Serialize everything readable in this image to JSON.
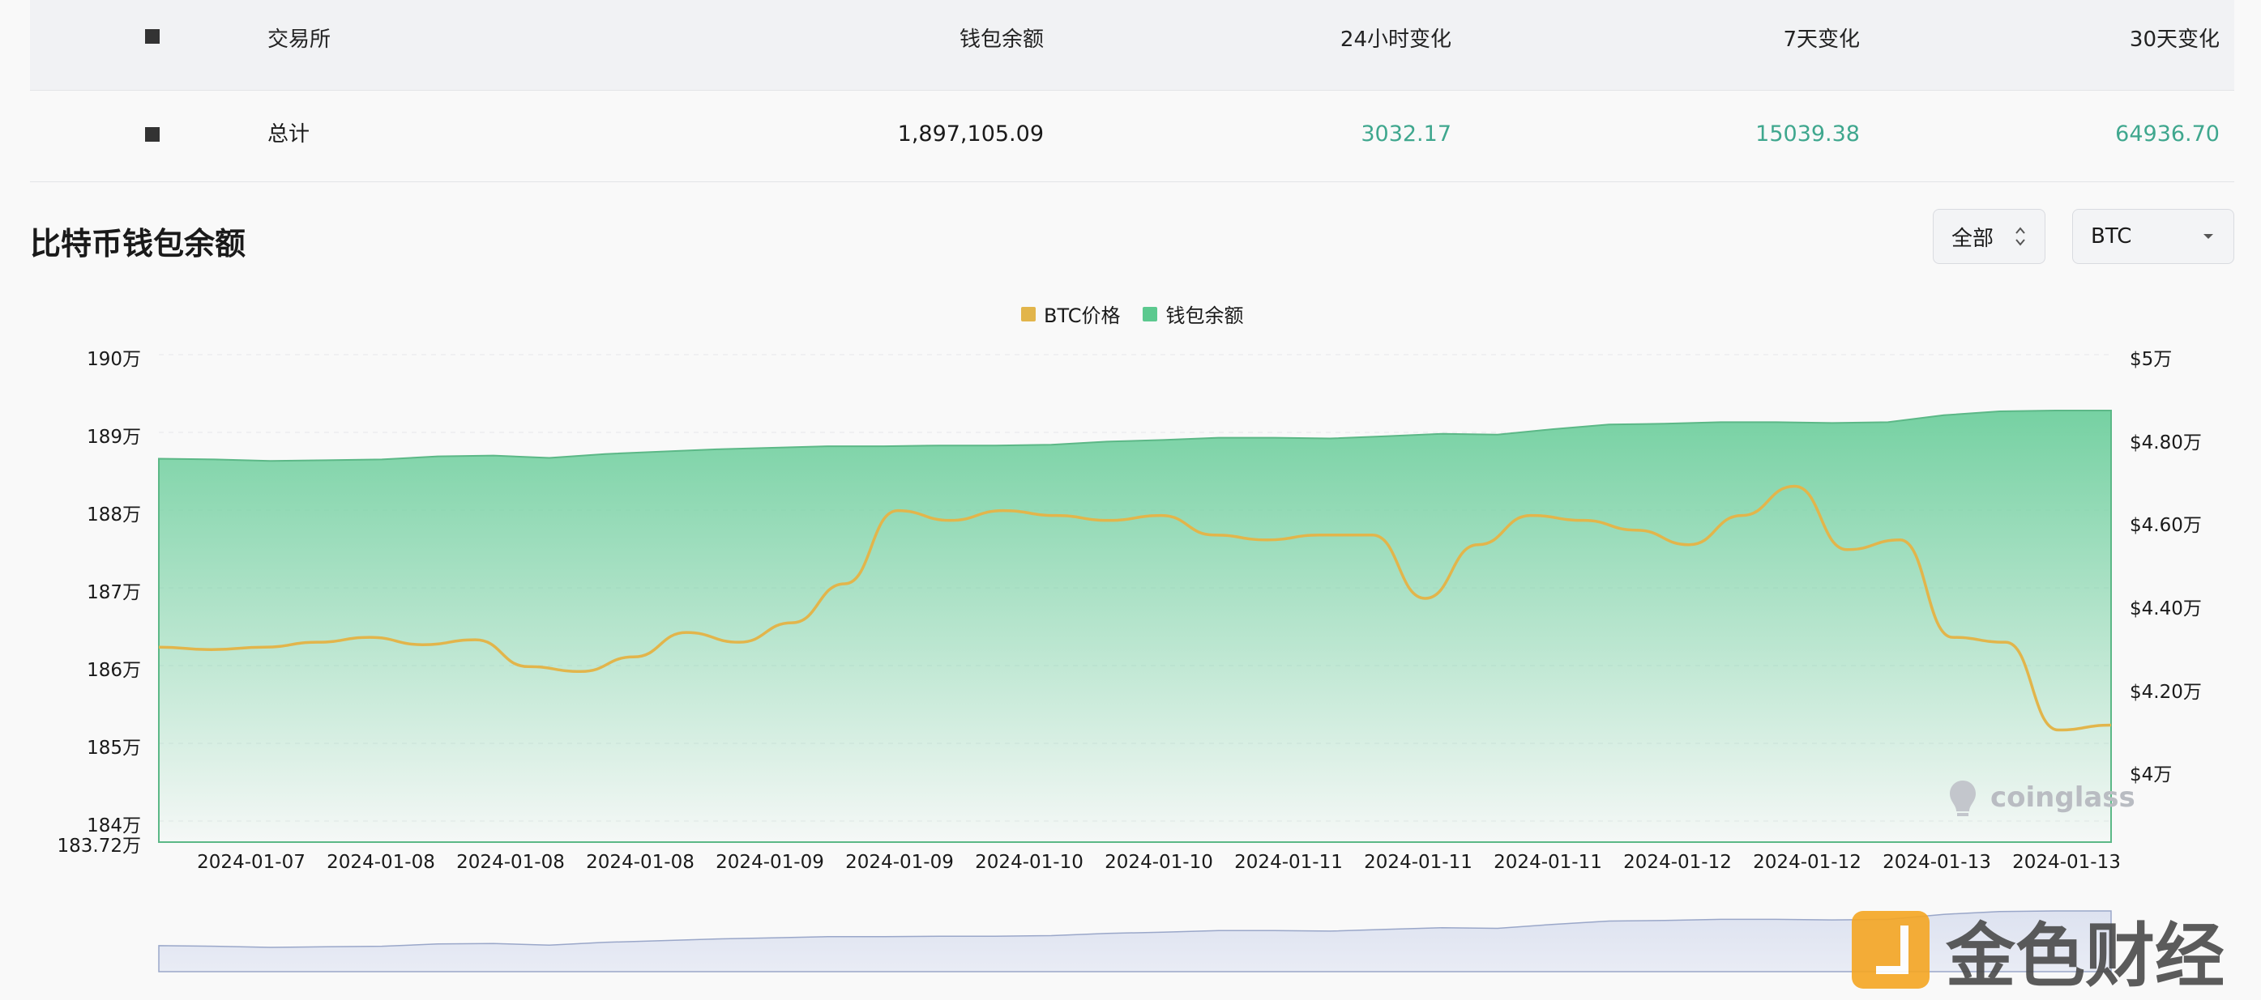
{
  "table": {
    "headers": [
      "交易所",
      "钱包余额",
      "24小时变化",
      "7天变化",
      "30天变化"
    ],
    "row": {
      "exchange": "总计",
      "balance": "1,897,105.09",
      "change_24h": "3032.17",
      "change_7d": "15039.38",
      "change_30d": "64936.70"
    }
  },
  "title": "比特币钱包余额",
  "controls": {
    "range": "全部",
    "asset": "BTC"
  },
  "watermark": "coinglass",
  "brand": "金色财经",
  "colors": {
    "price_line": "#e2b54b",
    "balance_fill": "#5cc98f",
    "positive": "#3fa78e"
  },
  "chart_data": {
    "type": "line",
    "legend": [
      "BTC价格",
      "钱包余额"
    ],
    "x_labels": [
      "2024-01-07",
      "2024-01-08",
      "2024-01-08",
      "2024-01-08",
      "2024-01-09",
      "2024-01-09",
      "2024-01-10",
      "2024-01-10",
      "2024-01-11",
      "2024-01-11",
      "2024-01-11",
      "2024-01-12",
      "2024-01-12",
      "2024-01-13",
      "2024-01-13"
    ],
    "left_axis": {
      "ticks": [
        "190万",
        "189万",
        "188万",
        "187万",
        "186万",
        "185万",
        "184万",
        "183.72万"
      ],
      "min": 1837200,
      "max": 1900000
    },
    "right_axis": {
      "ticks": [
        "$5万",
        "$4.80万",
        "$4.60万",
        "$4.40万",
        "$4.20万",
        "$4万"
      ],
      "min": 40000,
      "max": 50000
    },
    "series": [
      {
        "name": "钱包余额",
        "axis": "left",
        "values": [
          1886600,
          1886500,
          1886300,
          1886400,
          1886500,
          1886900,
          1887000,
          1886700,
          1887200,
          1887500,
          1887800,
          1888000,
          1888200,
          1888200,
          1888300,
          1888300,
          1888400,
          1888800,
          1889000,
          1889300,
          1889300,
          1889200,
          1889500,
          1889800,
          1889700,
          1890400,
          1891000,
          1891100,
          1891300,
          1891300,
          1891200,
          1891300,
          1892200,
          1892700,
          1892800,
          1892800
        ]
      },
      {
        "name": "BTC价格",
        "axis": "right",
        "values": [
          44000,
          43950,
          44000,
          44100,
          44200,
          44050,
          44150,
          43600,
          43500,
          43800,
          44300,
          44100,
          44500,
          45300,
          46800,
          46600,
          46800,
          46700,
          46600,
          46700,
          46300,
          46200,
          46300,
          46300,
          45000,
          46100,
          46700,
          46600,
          46400,
          46100,
          46700,
          47300,
          46000,
          46200,
          44200,
          44100,
          42300,
          42400
        ]
      }
    ]
  }
}
